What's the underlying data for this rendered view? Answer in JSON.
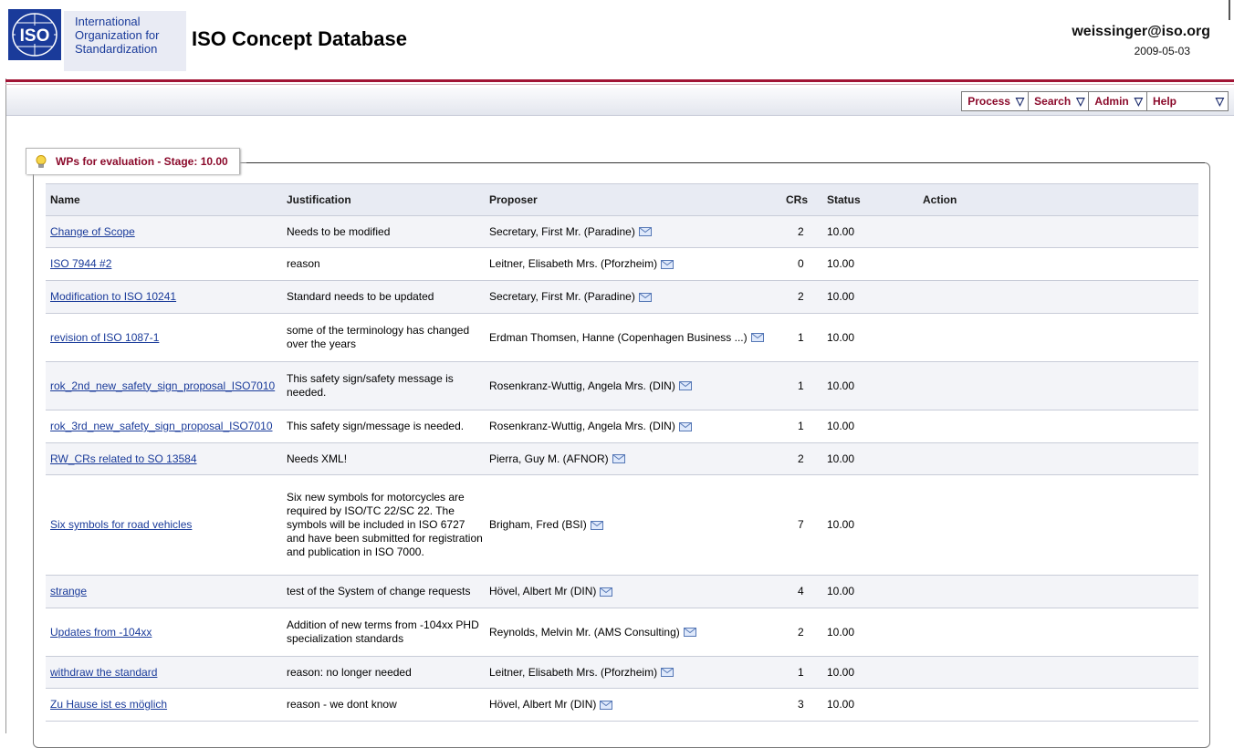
{
  "header": {
    "org_lines": [
      "International",
      "Organization for",
      "Standardization"
    ],
    "app_title": "ISO Concept Database",
    "user_email": "weissinger@iso.org",
    "date": "2009-05-03"
  },
  "nav": {
    "items": [
      {
        "label": "Process"
      },
      {
        "label": "Search"
      },
      {
        "label": "Admin"
      },
      {
        "label": "Help"
      }
    ]
  },
  "panel": {
    "title": "WPs for evaluation - Stage: 10.00",
    "columns": [
      "Name",
      "Justification",
      "Proposer",
      "CRs",
      "Status",
      "Action"
    ],
    "rows": [
      {
        "name": "Change of Scope",
        "justification": "Needs to be modified",
        "proposer": "Secretary, First Mr. (Paradine)",
        "crs": "2",
        "status": "10.00"
      },
      {
        "name": "ISO 7944 #2",
        "justification": "reason",
        "proposer": "Leitner, Elisabeth Mrs. (Pforzheim)",
        "crs": "0",
        "status": "10.00"
      },
      {
        "name": "Modification to ISO 10241",
        "justification": "Standard needs to be updated",
        "proposer": "Secretary, First Mr. (Paradine)",
        "crs": "2",
        "status": "10.00"
      },
      {
        "name": "revision of ISO 1087-1",
        "justification": "some of the terminology has changed over the years",
        "proposer": "Erdman Thomsen, Hanne (Copenhagen Business ...)",
        "crs": "1",
        "status": "10.00"
      },
      {
        "name": "rok_2nd_new_safety_sign_proposal_ISO7010",
        "justification": "This safety sign/safety message is needed.",
        "proposer": "Rosenkranz-Wuttig, Angela Mrs. (DIN)",
        "crs": "1",
        "status": "10.00"
      },
      {
        "name": "rok_3rd_new_safety_sign_proposal_ISO7010",
        "justification": "This safety sign/message is needed.",
        "proposer": "Rosenkranz-Wuttig, Angela Mrs. (DIN)",
        "crs": "1",
        "status": "10.00"
      },
      {
        "name": "RW_CRs related to SO 13584",
        "justification": "Needs XML!",
        "proposer": "Pierra, Guy M. (AFNOR)",
        "crs": "2",
        "status": "10.00"
      },
      {
        "name": "Six symbols for road vehicles",
        "justification": "Six new symbols for motorcycles are required by ISO/TC 22/SC 22. The symbols will be included in ISO 6727 and have been submitted for registration and publication in ISO 7000.",
        "proposer": "Brigham, Fred (BSI)",
        "crs": "7",
        "status": "10.00"
      },
      {
        "name": "strange",
        "justification": "test of the System of change requests",
        "proposer": "Hövel, Albert Mr (DIN)",
        "crs": "4",
        "status": "10.00"
      },
      {
        "name": "Updates from -104xx",
        "justification": "Addition of new terms from -104xx PHD specialization standards",
        "proposer": "Reynolds, Melvin Mr. (AMS Consulting)",
        "crs": "2",
        "status": "10.00"
      },
      {
        "name": "withdraw the standard",
        "justification": "reason: no longer needed",
        "proposer": "Leitner, Elisabeth Mrs. (Pforzheim)",
        "crs": "1",
        "status": "10.00"
      },
      {
        "name": "Zu Hause ist es möglich",
        "justification": "reason - we dont know",
        "proposer": "Hövel, Albert Mr (DIN)",
        "crs": "3",
        "status": "10.00"
      }
    ]
  }
}
